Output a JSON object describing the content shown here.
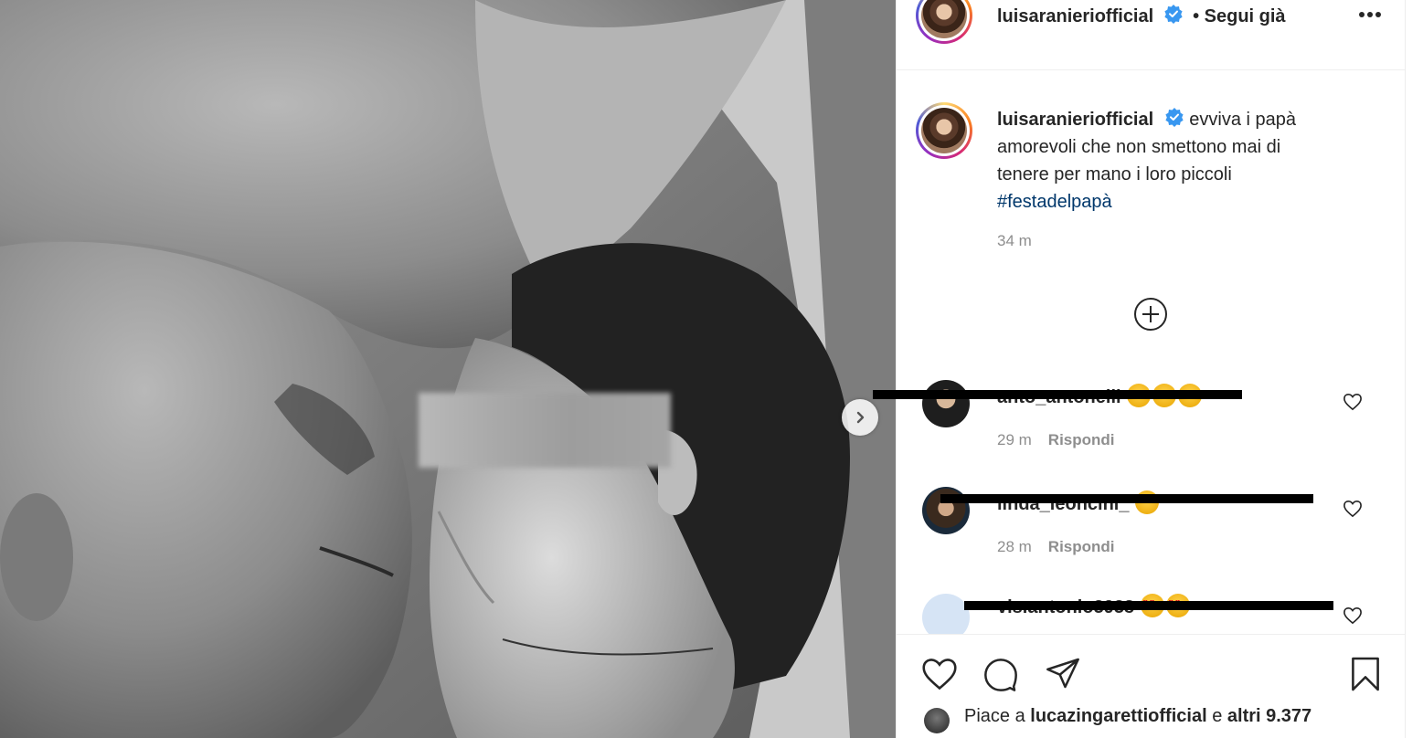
{
  "post": {
    "username": "luisaranieriofficial",
    "follow_status": "• Segui già",
    "caption": "evviva i papà amorevoli che non smettono mai di tenere per mano i loro piccoli",
    "caption_lines": [
      "evviva i papà",
      "amorevoli che non smettono mai di",
      "tenere per mano i loro piccoli"
    ],
    "hashtag": "#festadelpapà",
    "time": "34 m"
  },
  "comments": [
    {
      "username": "anto_antonelli",
      "time": "29 m",
      "reply": "Rispondi",
      "emoji_count": 3
    },
    {
      "username": "linda_leoncini_",
      "time": "28 m",
      "reply": "Rispondi",
      "emoji_count": 1
    },
    {
      "username": "vis.antonio3938",
      "emoji_count": 2
    }
  ],
  "likes": {
    "prefix": "Piace a ",
    "user": "lucazingarettiofficial",
    "middle": " e ",
    "others": "altri 9.377"
  },
  "icons": [
    "verified-icon",
    "more-options-icon",
    "add-comment-icon",
    "chevron-right-icon",
    "heart-icon",
    "comment-icon",
    "share-icon",
    "bookmark-icon"
  ],
  "colors": {
    "ring_start": "#feda75",
    "ring_end": "#962fbf",
    "verified": "#3897f0",
    "hashtag": "#00376b",
    "meta": "#8e8e8e"
  }
}
